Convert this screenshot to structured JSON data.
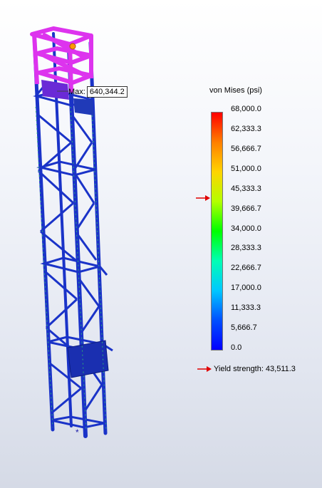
{
  "legend": {
    "title": "von Mises (psi)",
    "ticks": [
      "68,000.0",
      "62,333.3",
      "56,666.7",
      "51,000.0",
      "45,333.3",
      "39,666.7",
      "34,000.0",
      "28,333.3",
      "22,666.7",
      "17,000.0",
      "11,333.3",
      "5,666.7",
      "0.0"
    ],
    "min": 0,
    "max": 68000,
    "colors": [
      "#ff0000",
      "#ff7f00",
      "#ffd400",
      "#b4ff00",
      "#00ff00",
      "#00ffb4",
      "#00c8ff",
      "#0050ff",
      "#0000ff"
    ]
  },
  "max_marker": {
    "label": "Max:",
    "value": "640,344.2"
  },
  "yield": {
    "label": "Yield strength:",
    "value": "43,511.3",
    "value_numeric": 43511.3,
    "arrow_color": "#e00000"
  },
  "model": {
    "structure_color": "#1a33c8",
    "high_stress_color": "#dd33ee",
    "peak_point_color": "#ff9900"
  }
}
